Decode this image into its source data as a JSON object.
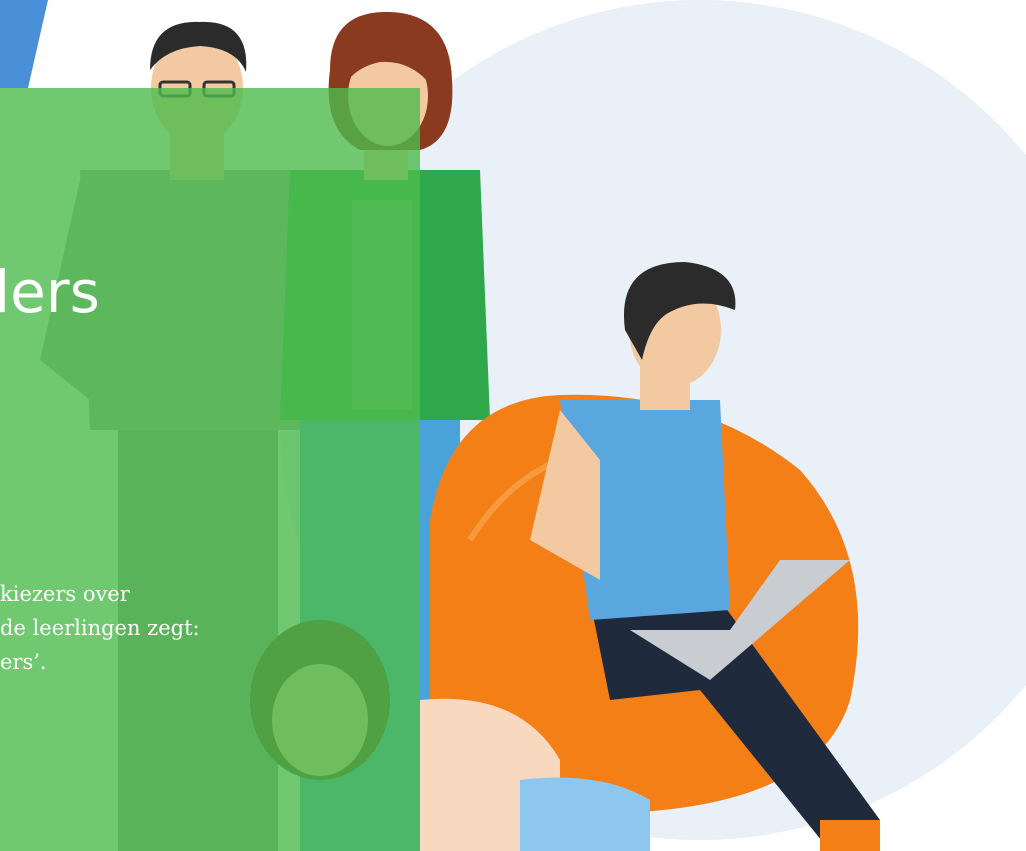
{
  "hero": {
    "heading": "lers",
    "body_lines": [
      "kiezers over",
      "de leerlingen zegt:",
      "ers’."
    ]
  },
  "illustration": {
    "subjects": [
      "standing-man",
      "standing-woman",
      "seated-young-man-with-laptop",
      "lying-girl"
    ]
  },
  "colors": {
    "panel_green": "#4cbb4c",
    "circle_backdrop": "#e9f0f8",
    "accent_blue": "#4a90d9",
    "beanbag_orange": "#f57f17",
    "shirt_blue": "#5aa7e0",
    "pants_navy": "#1f2a3c",
    "hair_dark": "#2b2b2b",
    "hair_auburn": "#8a3a1e",
    "skin": "#f2c9a0"
  }
}
